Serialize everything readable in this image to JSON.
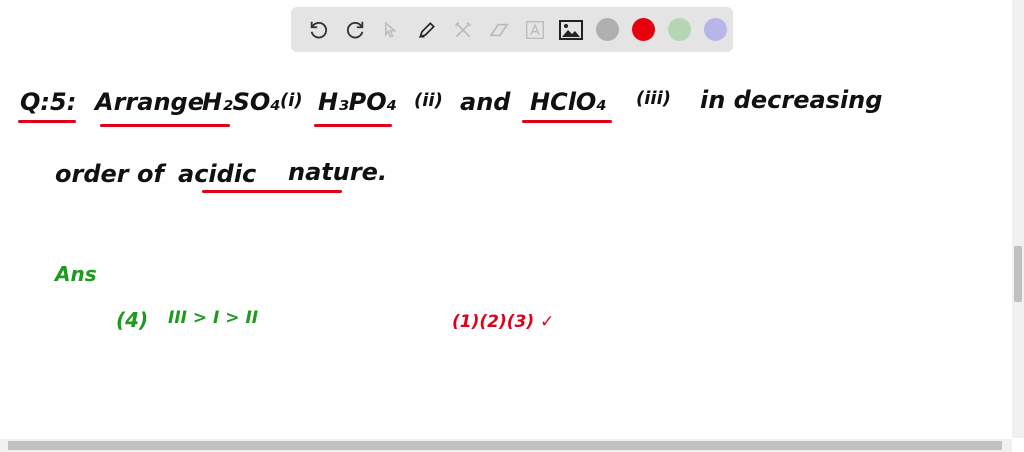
{
  "toolbar": {
    "tools": [
      "undo-icon",
      "redo-icon",
      "select-icon",
      "pen-icon",
      "tools-icon",
      "eraser-icon",
      "text-icon",
      "image-icon"
    ],
    "colors": [
      "#b0b0b0",
      "#e8000e",
      "#b5d6b5",
      "#b8b5e8"
    ]
  },
  "board": {
    "question": {
      "label": "Q:5:",
      "w1": "Arrange",
      "w2": "H₂SO₄",
      "n1": "(i)",
      "w3": "H₃PO₄",
      "n2": "(ii)",
      "w4": "and",
      "w5": "HClO₄",
      "n3": "(iii)",
      "w6": "in decreasing",
      "line2a": "order of",
      "line2b": "acidic",
      "line2c": "nature."
    },
    "answer": {
      "label": "Ans",
      "option": "(4)",
      "order": "III > I > II",
      "red_marks": "(1)(2)(3) ✓"
    }
  }
}
